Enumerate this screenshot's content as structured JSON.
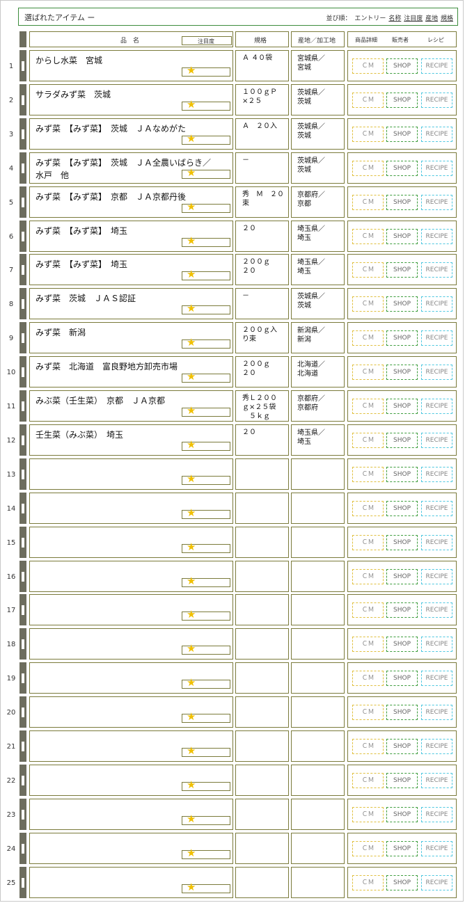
{
  "title": "選ばれたアイテム ー",
  "sort": {
    "label": "並び順：",
    "options": [
      "エントリー",
      "名称",
      "注目度",
      "産地",
      "規格"
    ]
  },
  "columns": {
    "name": "品　名",
    "attention": "注目度",
    "spec": "規格",
    "origin": "産地／加工地",
    "detail": "商品詳細",
    "seller": "販売者",
    "recipe": "レシピ"
  },
  "buttons": {
    "cm": "ＣＭ",
    "shop": "SHOP",
    "recipe": "RECIPE"
  },
  "rows": [
    {
      "rank": "1",
      "name": "からし水菜　宮城",
      "spec": "Ａ ４０袋",
      "origin": "宮城県／\n宮城"
    },
    {
      "rank": "2",
      "name": "サラダみず菜　茨城",
      "spec": "１００ｇＰ\n×２５",
      "origin": "茨城県／\n茨城"
    },
    {
      "rank": "3",
      "name": "みず菜　【みず菜】　茨城　ＪＡなめがた",
      "spec": "Ａ　２０入",
      "origin": "茨城県／\n茨城"
    },
    {
      "rank": "4",
      "name": "みず菜　【みず菜】　茨城　ＪＡ全農いばらき／\n水戸　他",
      "spec": "－",
      "origin": "茨城県／\n茨城"
    },
    {
      "rank": "5",
      "name": "みず菜　【みず菜】　京都　ＪＡ京都丹後",
      "spec": "秀　Ｍ　２０\n束",
      "origin": "京都府／\n京都"
    },
    {
      "rank": "6",
      "name": "みず菜　【みず菜】　埼玉",
      "spec": "２０",
      "origin": "埼玉県／\n埼玉"
    },
    {
      "rank": "7",
      "name": "みず菜　【みず菜】　埼玉",
      "spec": "２００ｇ\n２０",
      "origin": "埼玉県／\n埼玉"
    },
    {
      "rank": "8",
      "name": "みず菜　茨城　ＪＡＳ認証",
      "spec": "－",
      "origin": "茨城県／\n茨城"
    },
    {
      "rank": "9",
      "name": "みず菜　新潟",
      "spec": "２００ｇ入\nり束",
      "origin": "新潟県／\n新潟"
    },
    {
      "rank": "10",
      "name": "みず菜　北海道　富良野地方卸売市場",
      "spec": "２００ｇ\n２０",
      "origin": "北海道／\n北海道"
    },
    {
      "rank": "11",
      "name": "みぶ菜（壬生菜）　京都　ＪＡ京都",
      "spec": "秀Ｌ２００\nｇ×２５袋\n　５ｋｇ",
      "origin": "京都府／\n京都府"
    },
    {
      "rank": "12",
      "name": "壬生菜（みぶ菜）　埼玉",
      "spec": "２０",
      "origin": "埼玉県／\n埼玉"
    },
    {
      "rank": "13",
      "name": "",
      "spec": "",
      "origin": ""
    },
    {
      "rank": "14",
      "name": "",
      "spec": "",
      "origin": ""
    },
    {
      "rank": "15",
      "name": "",
      "spec": "",
      "origin": ""
    },
    {
      "rank": "16",
      "name": "",
      "spec": "",
      "origin": ""
    },
    {
      "rank": "17",
      "name": "",
      "spec": "",
      "origin": ""
    },
    {
      "rank": "18",
      "name": "",
      "spec": "",
      "origin": ""
    },
    {
      "rank": "19",
      "name": "",
      "spec": "",
      "origin": ""
    },
    {
      "rank": "20",
      "name": "",
      "spec": "",
      "origin": ""
    },
    {
      "rank": "21",
      "name": "",
      "spec": "",
      "origin": ""
    },
    {
      "rank": "22",
      "name": "",
      "spec": "",
      "origin": ""
    },
    {
      "rank": "23",
      "name": "",
      "spec": "",
      "origin": ""
    },
    {
      "rank": "24",
      "name": "",
      "spec": "",
      "origin": ""
    },
    {
      "rank": "25",
      "name": "",
      "spec": "",
      "origin": ""
    }
  ]
}
